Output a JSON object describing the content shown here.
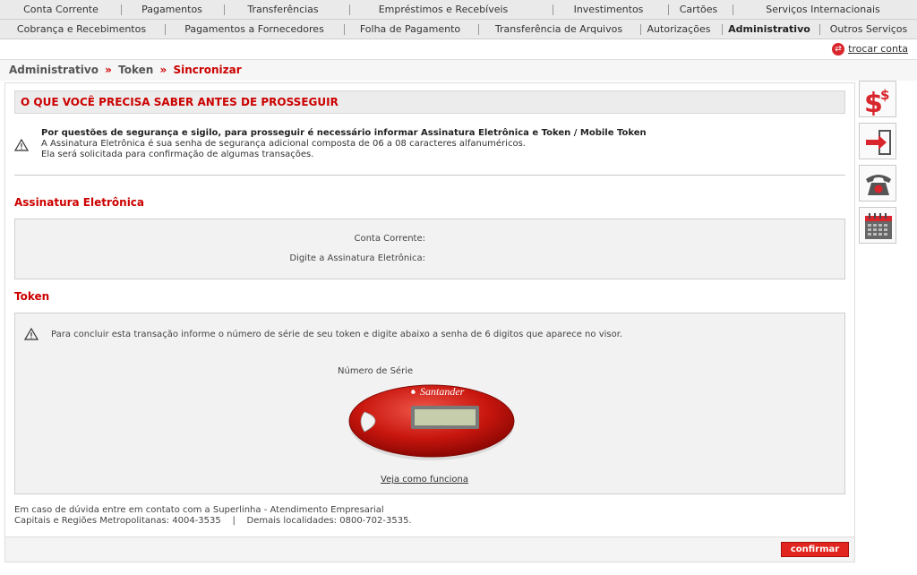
{
  "nav_top": [
    "Conta Corrente",
    "Pagamentos",
    "Transferências",
    "Empréstimos e Recebíveis",
    "Investimentos",
    "Cartões",
    "Serviços Internacionais"
  ],
  "nav_bottom": [
    "Cobrança e Recebimentos",
    "Pagamentos a Fornecedores",
    "Folha de Pagamento",
    "Transferência de Arquivos",
    "Autorizações",
    "Administrativo",
    "Outros Serviços"
  ],
  "active_nav": "Administrativo",
  "troca_conta": "trocar conta",
  "breadcrumb": {
    "items": [
      "Administrativo",
      "Token"
    ],
    "current": "Sincronizar",
    "separator": "»"
  },
  "warning_title": "O QUE VOCÊ PRECISA SABER ANTES DE PROSSEGUIR",
  "info": {
    "bold_line": "Por questões de segurança e sigilo, para prosseguir é necessário informar Assinatura Eletrônica e Token / Mobile Token",
    "line2": "A Assinatura Eletrônica é sua senha de segurança adicional composta de 06 a 08 caracteres alfanuméricos.",
    "line3": "Ela será solicitada para confirmação de algumas transações."
  },
  "assinatura": {
    "title": "Assinatura Eletrônica",
    "conta_label": "Conta Corrente:",
    "assinatura_label": "Digite a Assinatura Eletrônica:"
  },
  "token": {
    "title": "Token",
    "message": "Para concluir esta transação informe o número de série de seu token e digite abaixo a senha de 6 digitos que aparece no visor.",
    "serie_label": "Número de Série",
    "brand": "Santander",
    "veja_link": "Veja como funciona"
  },
  "footer": {
    "line1": "Em caso de dúvida entre em contato com a Superlinha - Atendimento Empresarial",
    "line2": "Capitais e Regiões Metropolitanas: 4004-3535    |    Demais localidades: 0800-702-3535."
  },
  "confirm_label": "confirmar",
  "colors": {
    "brand_red": "#cc0000",
    "button_red": "#e0261e",
    "nav_bg": "#eaeaea"
  },
  "side_icons": [
    "dollar-icon",
    "exit-arrow-icon",
    "telephone-icon",
    "calendar-icon"
  ]
}
